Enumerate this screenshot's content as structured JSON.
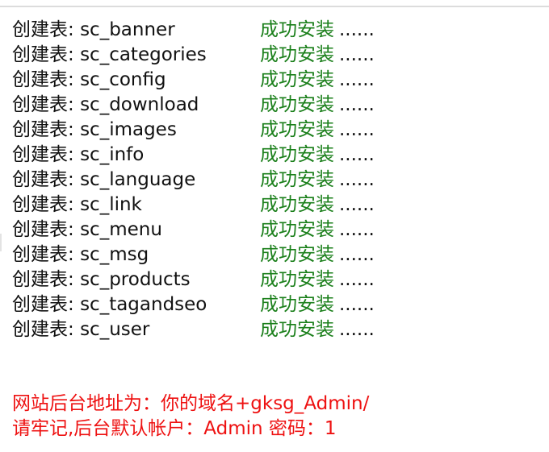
{
  "log": {
    "prefix": "创建表: ",
    "status_text": "成功安装",
    "trailing": "......",
    "tables": [
      "sc_banner",
      "sc_categories",
      "sc_config",
      "sc_download",
      "sc_images",
      "sc_info",
      "sc_language",
      "sc_link",
      "sc_menu",
      "sc_msg",
      "sc_products",
      "sc_tagandseo",
      "sc_user"
    ]
  },
  "notice": {
    "line1": "网站后台地址为：你的域名+gksg_Admin/",
    "line2": "请牢记,后台默认帐户：Admin 密码：1"
  },
  "colors": {
    "success": "#1a7f1a",
    "notice": "#ee1111",
    "text": "#111111"
  }
}
